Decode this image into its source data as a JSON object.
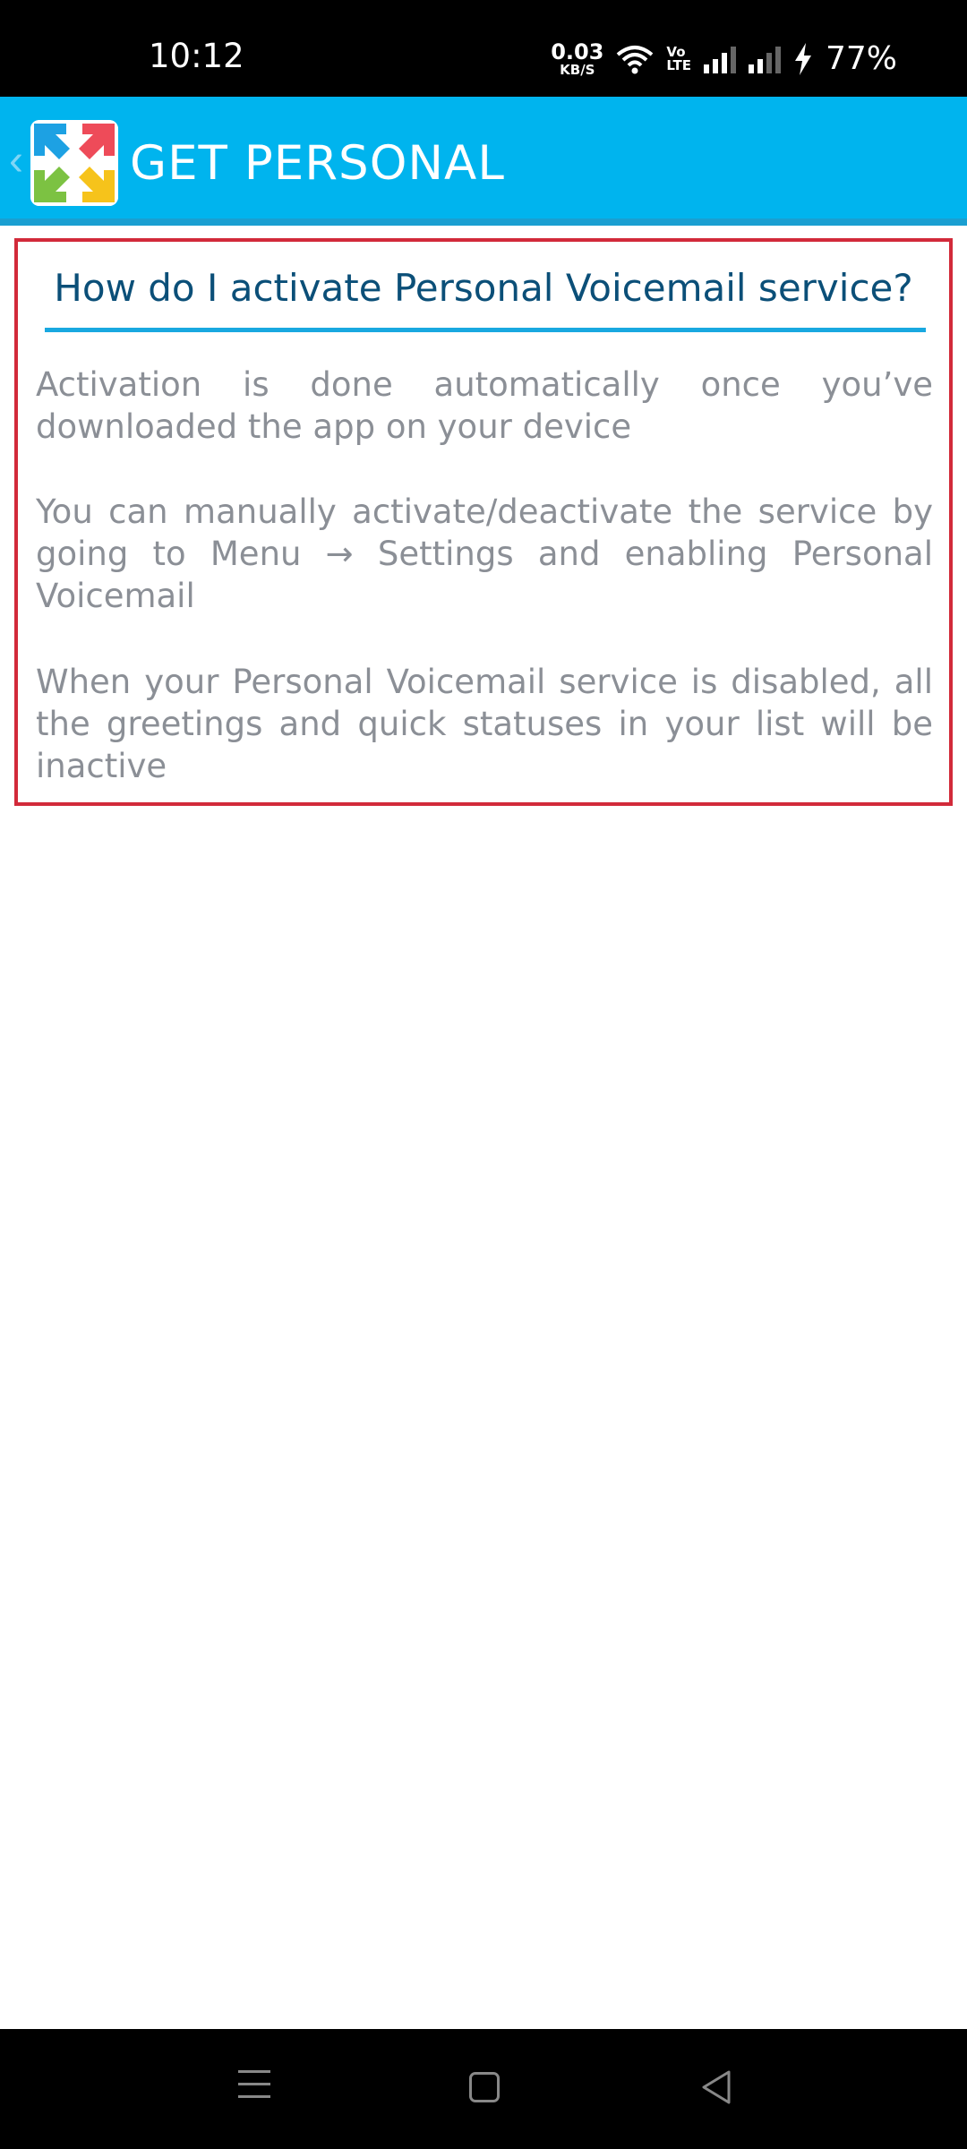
{
  "status_bar": {
    "time": "10:12",
    "net_speed_value": "0.03",
    "net_speed_unit": "KB/S",
    "volte_line1": "Vo",
    "volte_line2": "LTE",
    "battery": "77%",
    "icons": [
      "wifi-icon",
      "signal-icon",
      "signal-icon",
      "charging-icon"
    ]
  },
  "app_bar": {
    "back_glyph": "‹",
    "title": "GET PERSONAL",
    "background": "#00b4ee"
  },
  "faq": {
    "question": "How do I activate Personal Voicemail service?",
    "paragraphs": [
      "Activation is done automatically once you’ve downloaded the app on your device",
      "You can manually activate/deactivate the service by going to Menu → Settings and enabling Personal Voicemail",
      "When your Personal Voicemail service is disabled, all the greetings and quick statuses in your list will be inactive"
    ],
    "highlight_color": "#d22a3a",
    "question_color": "#0b4f78",
    "rule_color": "#19a8e0"
  },
  "nav_bar": {
    "icons": [
      "menu-icon",
      "home-icon",
      "back-icon"
    ]
  }
}
